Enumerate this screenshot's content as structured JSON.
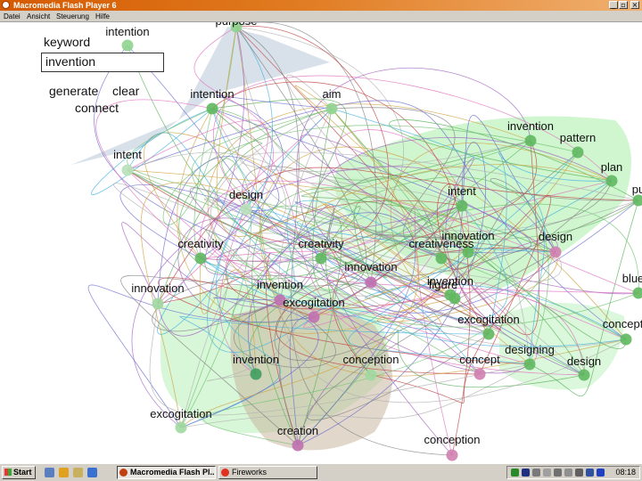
{
  "window": {
    "title": "Macromedia Flash Player 6"
  },
  "menu": [
    "Datei",
    "Ansicht",
    "Steuerung",
    "Hilfe"
  ],
  "controls": {
    "keyword_label": "keyword",
    "keyword_value": "invention",
    "generate_label": "generate",
    "clear_label": "clear",
    "connect_label": "connect"
  },
  "nodes": [
    {
      "label": "purpose",
      "color": "#8fd48f"
    },
    {
      "label": "intention",
      "color": "#8fd48f"
    },
    {
      "label": "intention",
      "color": "#5fb85f"
    },
    {
      "label": "aim",
      "color": "#8fd48f"
    },
    {
      "label": "intent",
      "color": "#b8e0b8"
    },
    {
      "label": "invention",
      "color": "#5fb85f"
    },
    {
      "label": "pattern",
      "color": "#5fb85f"
    },
    {
      "label": "plan",
      "color": "#5fb85f"
    },
    {
      "label": "pu",
      "color": "#5fb85f"
    },
    {
      "label": "design",
      "color": "#b8e0b8"
    },
    {
      "label": "intent",
      "color": "#5fb85f"
    },
    {
      "label": "creativity",
      "color": "#5fb85f"
    },
    {
      "label": "creativity",
      "color": "#5fb85f"
    },
    {
      "label": "creativeness",
      "color": "#5fb85f"
    },
    {
      "label": "innovation",
      "color": "#5fb85f"
    },
    {
      "label": "design",
      "color": "#d080b0"
    },
    {
      "label": "innovation",
      "color": "#c070b0"
    },
    {
      "label": "figure",
      "color": "#5fb85f"
    },
    {
      "label": "invention",
      "color": "#5fb85f"
    },
    {
      "label": "blue",
      "color": "#5fb85f"
    },
    {
      "label": "innovation",
      "color": "#a0d8a0"
    },
    {
      "label": "invention",
      "color": "#c070b0"
    },
    {
      "label": "excogitation",
      "color": "#c070b0"
    },
    {
      "label": "excogitation",
      "color": "#5fb85f"
    },
    {
      "label": "concepti",
      "color": "#5fb85f"
    },
    {
      "label": "designing",
      "color": "#5fb85f"
    },
    {
      "label": "invention",
      "color": "#3f9f5f"
    },
    {
      "label": "conception",
      "color": "#a0d8a0"
    },
    {
      "label": "concept",
      "color": "#d080b0"
    },
    {
      "label": "design",
      "color": "#5fb85f"
    },
    {
      "label": "excogitation",
      "color": "#a0d8a0"
    },
    {
      "label": "creation",
      "color": "#c070b0"
    },
    {
      "label": "conception",
      "color": "#d080b0"
    }
  ],
  "taskbar": {
    "start_label": "Start",
    "tasks": [
      "Macromedia Flash Pl...",
      "Fireworks"
    ],
    "clock": "08:18"
  }
}
